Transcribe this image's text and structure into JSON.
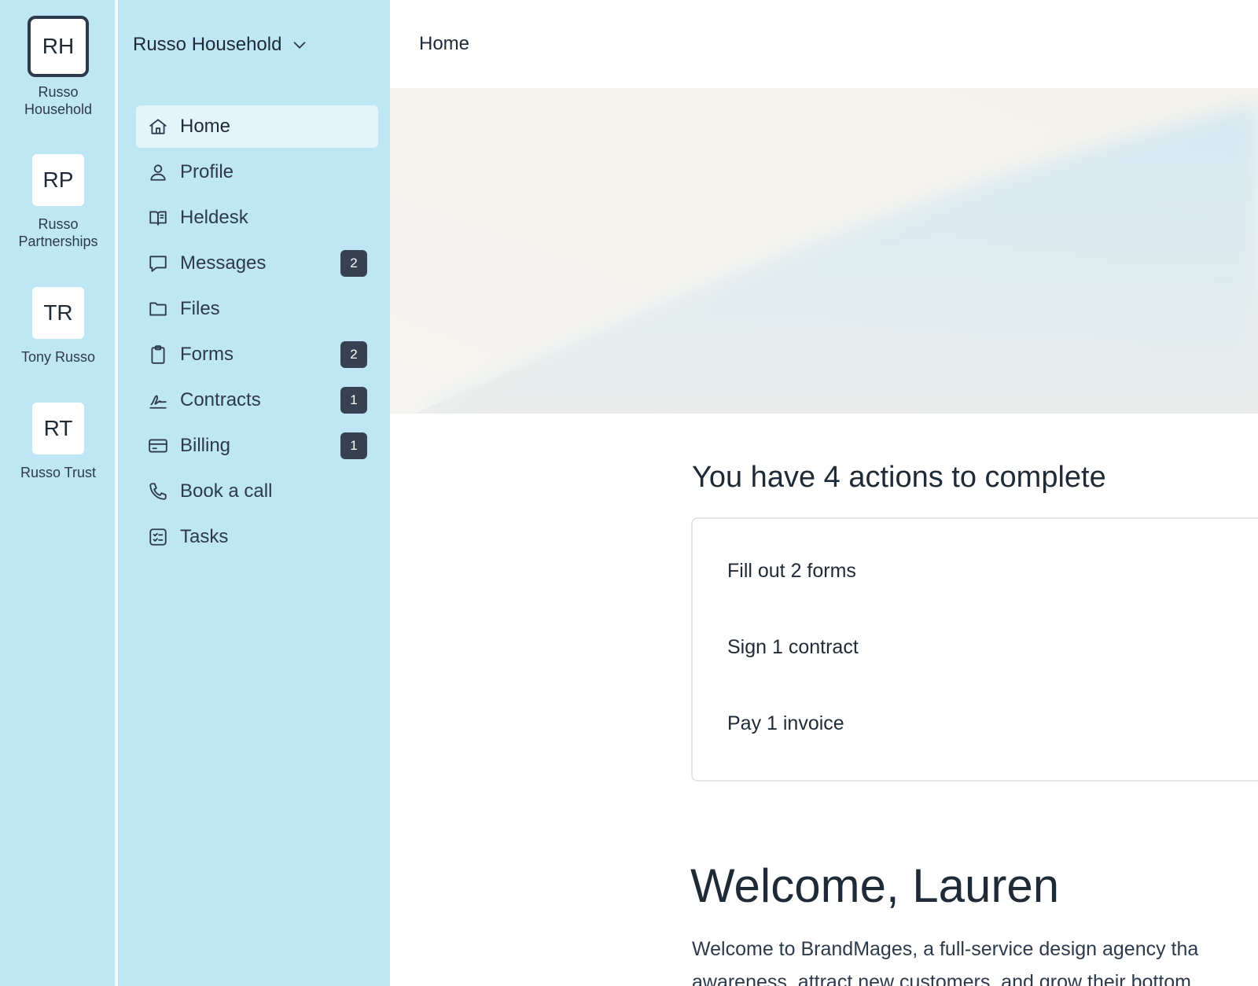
{
  "accounts": [
    {
      "initials": "RH",
      "name": "Russo Household",
      "active": true
    },
    {
      "initials": "RP",
      "name": "Russo Partnerships",
      "active": false
    },
    {
      "initials": "TR",
      "name": "Tony Russo",
      "active": false
    },
    {
      "initials": "RT",
      "name": "Russo Trust",
      "active": false
    }
  ],
  "switcher": {
    "label": "Russo Household",
    "icon": "chevron-down-icon"
  },
  "nav": {
    "items": [
      {
        "label": "Home",
        "icon": "home-icon",
        "active": true
      },
      {
        "label": "Profile",
        "icon": "user-icon"
      },
      {
        "label": "Heldesk",
        "icon": "book-icon"
      },
      {
        "label": "Messages",
        "icon": "chat-icon",
        "badge": "2"
      },
      {
        "label": "Files",
        "icon": "folder-icon"
      },
      {
        "label": "Forms",
        "icon": "clipboard-icon",
        "badge": "2"
      },
      {
        "label": "Contracts",
        "icon": "signature-icon",
        "badge": "1"
      },
      {
        "label": "Billing",
        "icon": "credit-card-icon",
        "badge": "1"
      },
      {
        "label": "Book a call",
        "icon": "phone-icon"
      },
      {
        "label": "Tasks",
        "icon": "checklist-icon"
      }
    ]
  },
  "header": {
    "title": "Home"
  },
  "actions": {
    "title": "You have 4 actions to complete",
    "items": [
      "Fill out 2 forms",
      "Sign 1 contract",
      "Pay 1 invoice"
    ]
  },
  "welcome": {
    "title": "Welcome, Lauren",
    "lines": [
      "Welcome to BrandMages, a full-service design agency tha",
      "awareness, attract new customers, and grow their bottom"
    ]
  },
  "colors": {
    "sidebar_bg": "#bee6f5",
    "active_item_bg": "#e3f4fb",
    "badge_bg": "#374151",
    "text": "#1f2a37"
  }
}
